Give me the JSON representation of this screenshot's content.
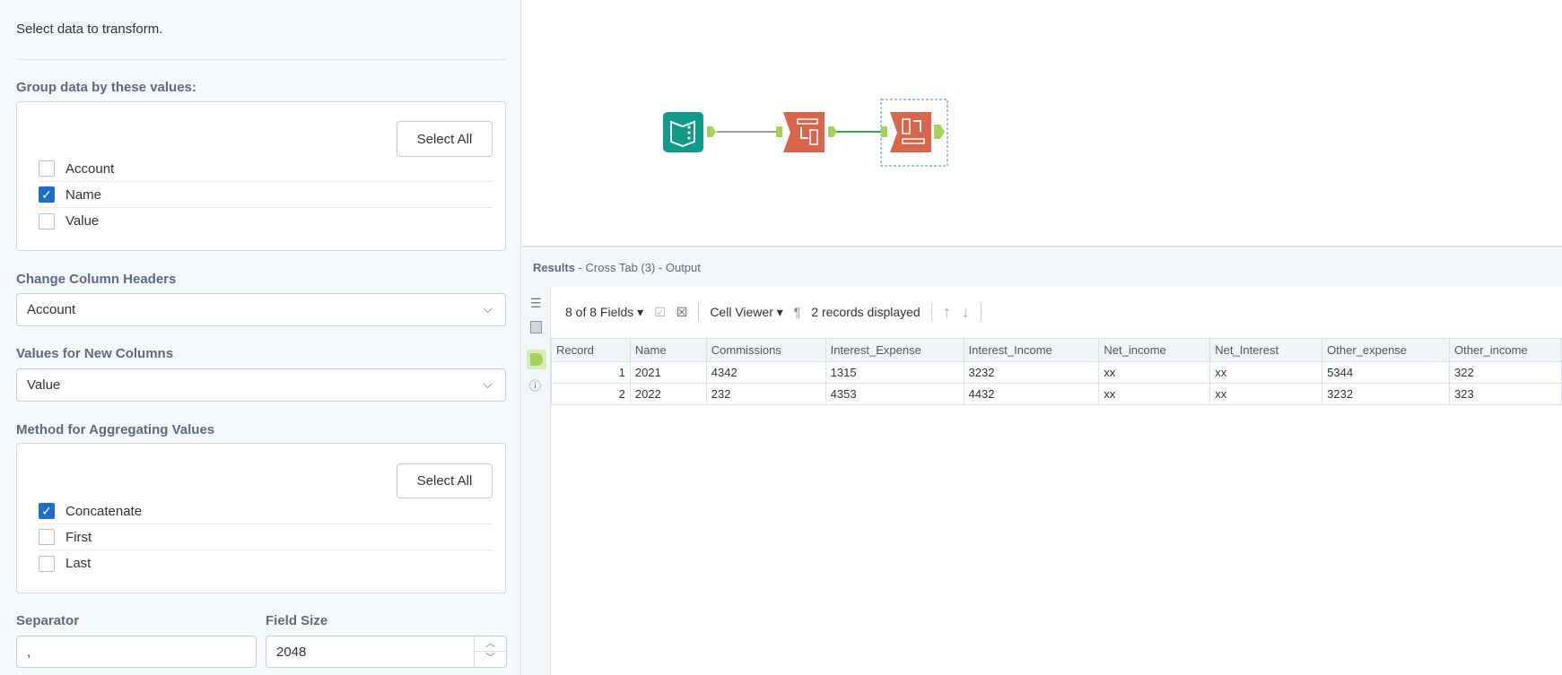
{
  "config": {
    "intro": "Select data to transform.",
    "group_label": "Group data by these values:",
    "select_all": "Select All",
    "group_fields": [
      {
        "label": "Account",
        "checked": false
      },
      {
        "label": "Name",
        "checked": true
      },
      {
        "label": "Value",
        "checked": false
      }
    ],
    "change_headers_label": "Change Column Headers",
    "change_headers_value": "Account",
    "values_label": "Values for New Columns",
    "values_value": "Value",
    "method_label": "Method for Aggregating Values",
    "methods": [
      {
        "label": "Concatenate",
        "checked": true
      },
      {
        "label": "First",
        "checked": false
      },
      {
        "label": "Last",
        "checked": false
      }
    ],
    "separator_label": "Separator",
    "separator_value": ",",
    "field_size_label": "Field Size",
    "field_size_value": "2048"
  },
  "results": {
    "title": "Results",
    "subtitle": " - Cross Tab (3) - Output",
    "fields_label": "8 of 8 Fields",
    "cell_viewer": "Cell Viewer",
    "records_displayed": "2 records displayed",
    "columns": [
      "Record",
      "Name",
      "Commissions",
      "Interest_Expense",
      "Interest_Income",
      "Net_income",
      "Net_Interest",
      "Other_expense",
      "Other_income"
    ],
    "rows": [
      [
        "1",
        "2021",
        "4342",
        "1315",
        "3232",
        "xx",
        "xx",
        "5344",
        "322"
      ],
      [
        "2",
        "2022",
        "232",
        "4353",
        "4432",
        "xx",
        "xx",
        "3232",
        "323"
      ]
    ]
  },
  "colors": {
    "accent": "#1e6fcc",
    "tool_orange": "#d9654b",
    "tool_teal": "#0f9a8a",
    "connector": "#a6d15a"
  }
}
